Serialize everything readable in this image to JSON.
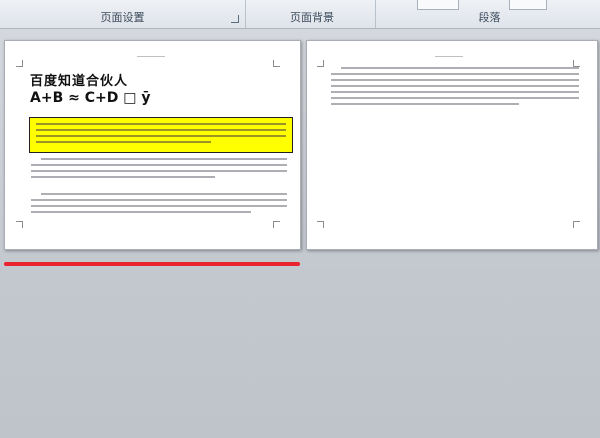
{
  "ribbon": {
    "groups": [
      {
        "label": "页面设置"
      },
      {
        "label": "页面背景"
      },
      {
        "label": "段落"
      }
    ]
  },
  "document": {
    "page1": {
      "title": "百度知道合伙人",
      "formula": "A+B ≈ C+D",
      "formula_tail": "□ ȳ"
    }
  },
  "colors": {
    "highlight": "#ffff00",
    "annotation_underline": "#e8232e"
  }
}
